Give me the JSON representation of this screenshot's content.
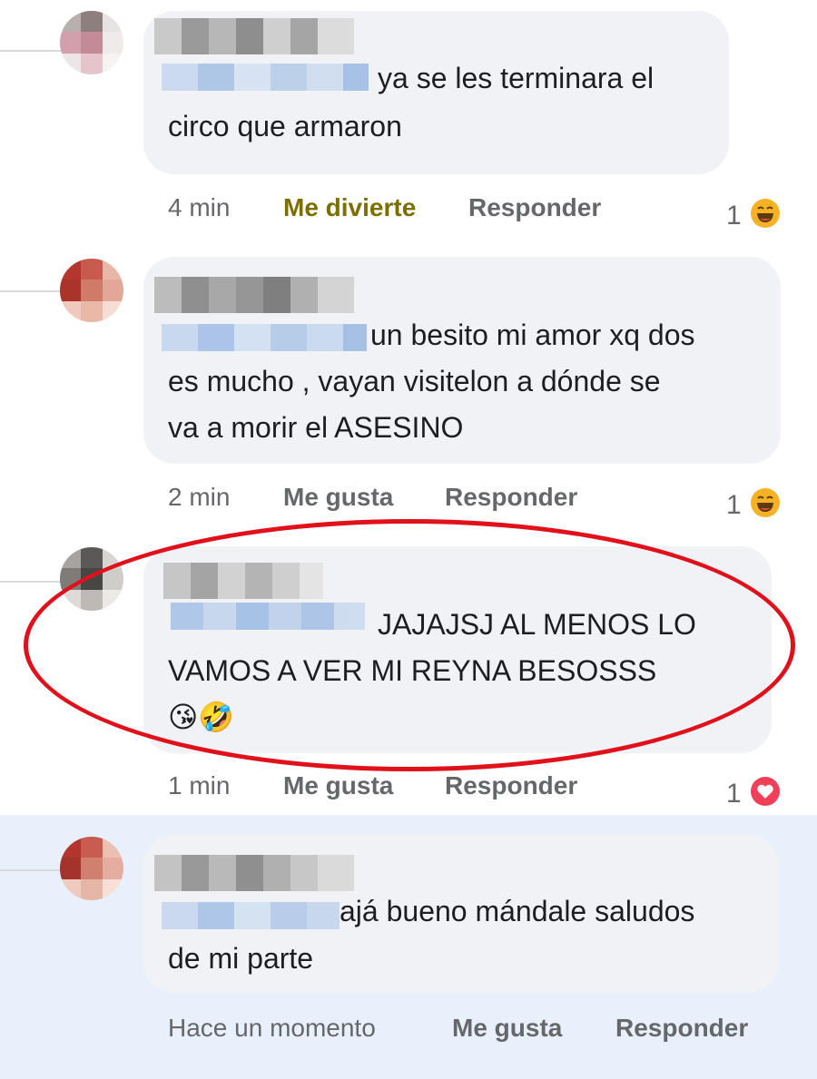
{
  "comments": [
    {
      "text_first": "ya se les terminara el",
      "text_rest": "circo que armaron",
      "time": "4 min",
      "reaction_action": "Me divierte",
      "reply": "Responder",
      "reaction_count": "1",
      "reaction_type": "laugh-emoji",
      "reaction_color": "#7a6f00"
    },
    {
      "text_first": "un besito mi amor xq dos",
      "text_rest_1": "es mucho , vayan visitelon a dónde se",
      "text_rest_2": "va a morir el ASESINO",
      "time": "2 min",
      "reaction_action": "Me gusta",
      "reply": "Responder",
      "reaction_count": "1",
      "reaction_type": "laugh-emoji"
    },
    {
      "text_first": "JAJAJSJ AL MENOS LO",
      "text_rest": "VAMOS A VER MI REYNA BESOSSS",
      "emojis": "😘🤣",
      "time": "1 min",
      "reaction_action": "Me gusta",
      "reply": "Responder",
      "reaction_count": "1",
      "reaction_type": "heart-icon"
    },
    {
      "text_first": "ajá bueno mándale saludos",
      "text_rest": "de mi parte",
      "time": "Hace un momento",
      "reaction_action": "Me gusta",
      "reply": "Responder"
    }
  ],
  "colors": {
    "highlight_ring": "#e0111b",
    "link_blue": "#385898",
    "bubble_bg": "#f0f2f5",
    "new_comment_bg": "#e8f1fb"
  }
}
